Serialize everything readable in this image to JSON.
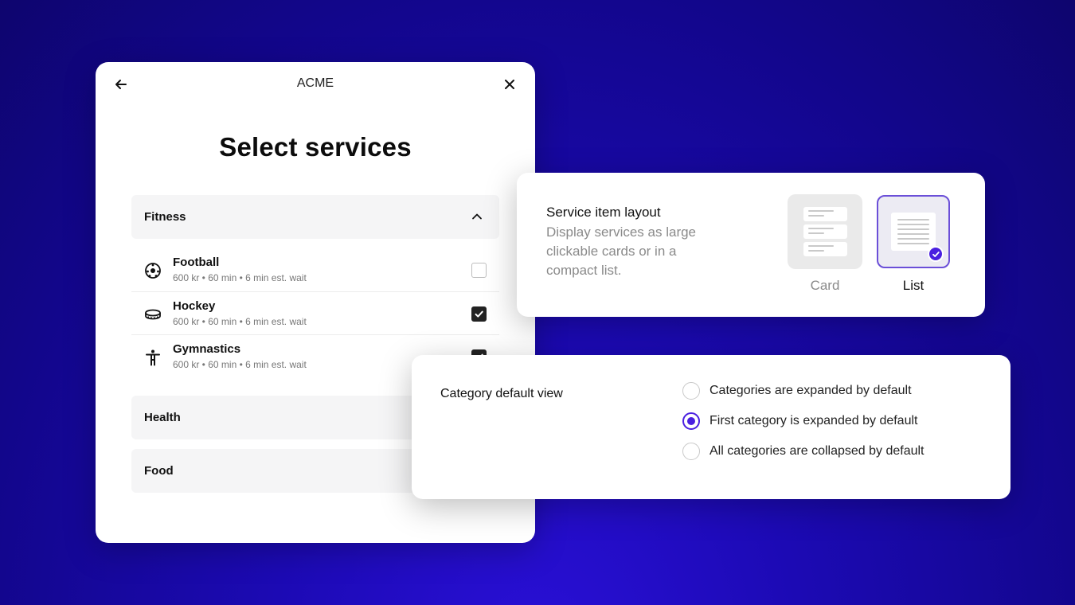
{
  "modal": {
    "title": "ACME",
    "heading": "Select services",
    "categories": [
      {
        "label": "Fitness",
        "expanded": true,
        "services": [
          {
            "name": "Football",
            "meta": "600 kr • 60 min • 6 min est. wait",
            "icon": "football-icon",
            "checked": false
          },
          {
            "name": "Hockey",
            "meta": "600 kr • 60 min • 6 min est. wait",
            "icon": "hockey-puck-icon",
            "checked": true
          },
          {
            "name": "Gymnastics",
            "meta": "600 kr • 60 min • 6 min est. wait",
            "icon": "gymnast-icon",
            "checked": true
          }
        ]
      },
      {
        "label": "Health",
        "expanded": false
      },
      {
        "label": "Food",
        "expanded": false
      }
    ]
  },
  "layout_panel": {
    "title": "Service item layout",
    "description": "Display services as large clickable cards or in a compact list.",
    "options": [
      {
        "label": "Card",
        "selected": false
      },
      {
        "label": "List",
        "selected": true
      }
    ]
  },
  "view_panel": {
    "title": "Category default view",
    "options": [
      {
        "label": "Categories are expanded by default",
        "selected": false
      },
      {
        "label": "First category is expanded by default",
        "selected": true
      },
      {
        "label": "All categories are collapsed by default",
        "selected": false
      }
    ]
  },
  "colors": {
    "background": "#1c0ab4",
    "accent": "#4a1fe0",
    "selected_tile_border": "#6b4fd8"
  }
}
